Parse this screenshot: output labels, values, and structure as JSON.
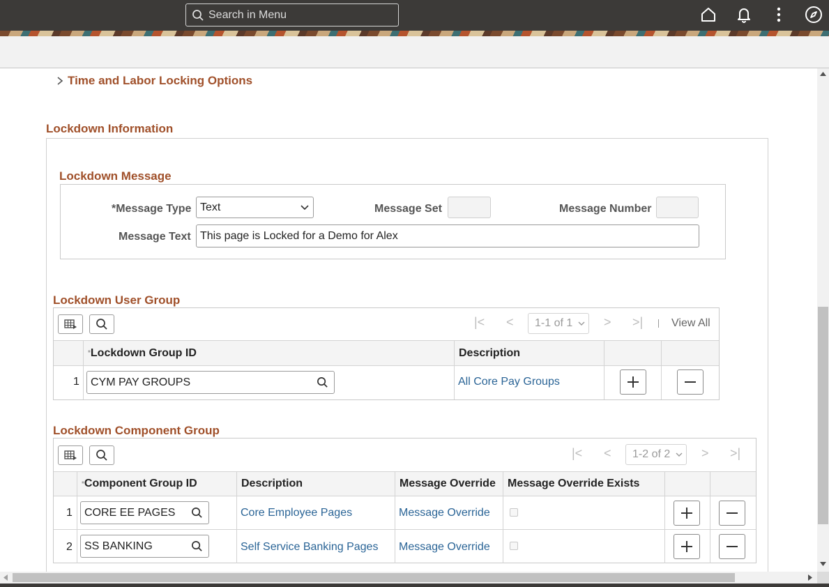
{
  "search": {
    "placeholder": "Search in Menu"
  },
  "icons": {
    "home": "home-icon",
    "bell": "bell-icon",
    "more": "more-vertical-icon",
    "compass": "compass-icon"
  },
  "colors": {
    "header_bg": "#3c3a38",
    "section_title": "#a0502a",
    "link": "#2a6496"
  },
  "collapsible": {
    "label": "Time and Labor Locking Options"
  },
  "lockdown": {
    "title": "Lockdown Information",
    "message": {
      "title": "Lockdown Message",
      "type_label": "*Message Type",
      "type_value": "Text",
      "set_label": "Message Set",
      "set_value": "",
      "number_label": "Message Number",
      "number_value": "",
      "text_label": "Message Text",
      "text_value": "This page is Locked for a Demo for Alex"
    },
    "user_group": {
      "title": "Lockdown User Group",
      "pager": "1-1 of 1",
      "view_all": "View All",
      "columns": [
        "Lockdown Group ID",
        "Description"
      ],
      "rows": [
        {
          "num": "1",
          "group_id": "CYM PAY GROUPS",
          "description": "All Core Pay Groups"
        }
      ]
    },
    "component_group": {
      "title": "Lockdown Component Group",
      "pager": "1-2 of 2",
      "columns": [
        "Component Group ID",
        "Description",
        "Message Override",
        "Message Override Exists"
      ],
      "rows": [
        {
          "num": "1",
          "group_id": "CORE EE PAGES",
          "description": "Core Employee Pages",
          "override": "Message Override",
          "exists": false
        },
        {
          "num": "2",
          "group_id": "SS BANKING",
          "description": "Self Service Banking Pages",
          "override": "Message Override",
          "exists": false
        }
      ]
    }
  }
}
